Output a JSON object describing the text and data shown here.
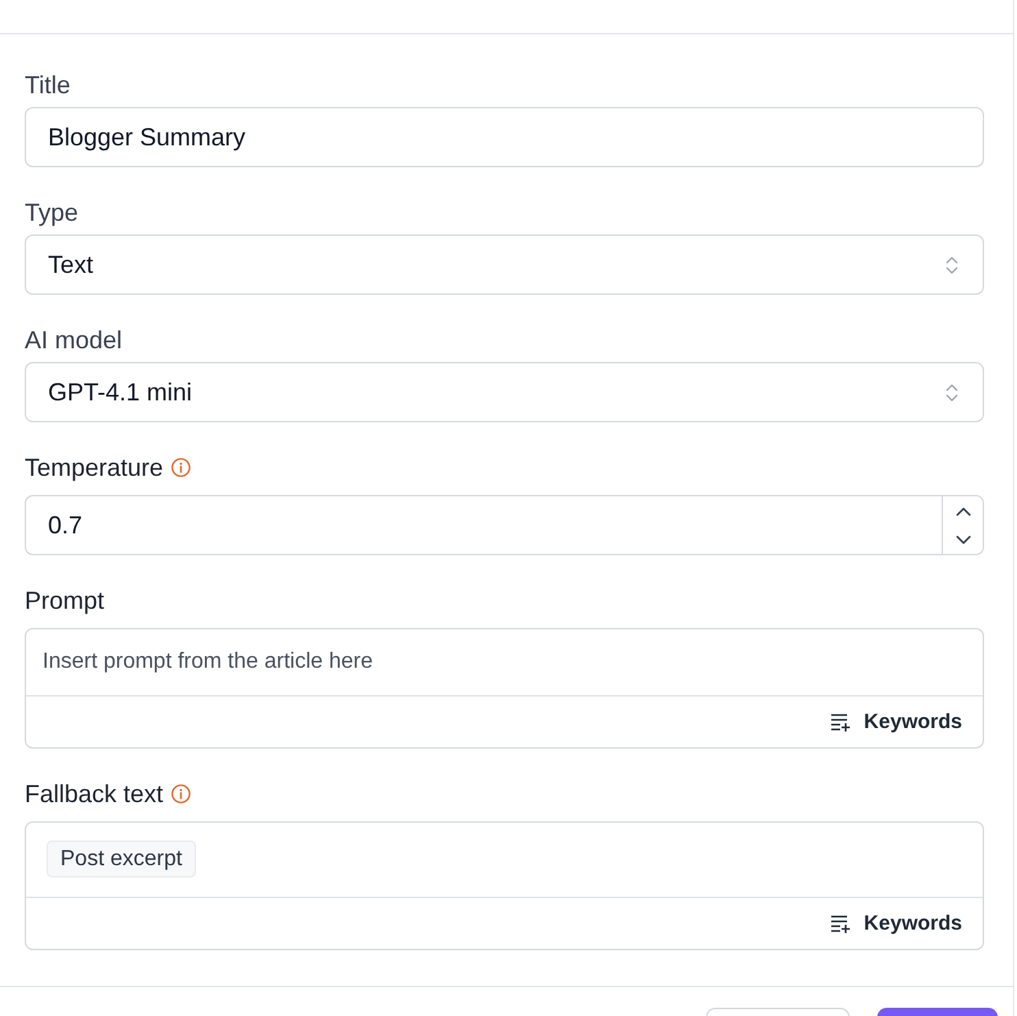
{
  "fields": [
    {
      "kind": "text",
      "label": "Title",
      "info": false,
      "value": "Blogger Summary"
    },
    {
      "kind": "select",
      "label": "Type",
      "info": false,
      "value": "Text"
    },
    {
      "kind": "select",
      "label": "AI model",
      "info": false,
      "value": "GPT-4.1 mini"
    },
    {
      "kind": "number",
      "label": "Temperature",
      "info": true,
      "value": "0.7"
    },
    {
      "kind": "editor",
      "label": "Prompt",
      "info": false,
      "placeholder": "Insert prompt from the article here",
      "action": "Keywords"
    },
    {
      "kind": "editor",
      "label": "Fallback text",
      "info": true,
      "chips": [
        "Post excerpt"
      ],
      "action": "Keywords"
    }
  ],
  "footer": {
    "buttons": [
      {
        "kind": "secondary"
      },
      {
        "kind": "primary"
      }
    ]
  }
}
